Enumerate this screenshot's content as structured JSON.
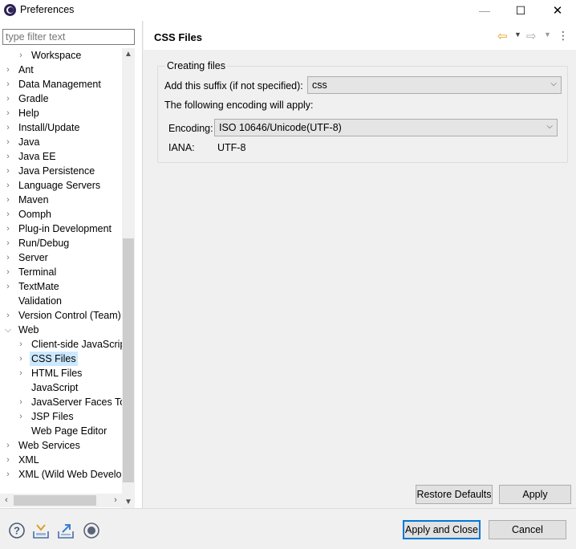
{
  "window": {
    "title": "Preferences",
    "minimize_label": "—",
    "maximize_label": "☐",
    "close_label": "✕"
  },
  "left": {
    "filter_placeholder": "type filter text",
    "tree": [
      {
        "label": "Workspace",
        "level": 1,
        "expandable": true
      },
      {
        "label": "Ant",
        "level": 0,
        "expandable": true
      },
      {
        "label": "Data Management",
        "level": 0,
        "expandable": true
      },
      {
        "label": "Gradle",
        "level": 0,
        "expandable": true
      },
      {
        "label": "Help",
        "level": 0,
        "expandable": true
      },
      {
        "label": "Install/Update",
        "level": 0,
        "expandable": true
      },
      {
        "label": "Java",
        "level": 0,
        "expandable": true
      },
      {
        "label": "Java EE",
        "level": 0,
        "expandable": true
      },
      {
        "label": "Java Persistence",
        "level": 0,
        "expandable": true
      },
      {
        "label": "Language Servers",
        "level": 0,
        "expandable": true
      },
      {
        "label": "Maven",
        "level": 0,
        "expandable": true
      },
      {
        "label": "Oomph",
        "level": 0,
        "expandable": true
      },
      {
        "label": "Plug-in Development",
        "level": 0,
        "expandable": true
      },
      {
        "label": "Run/Debug",
        "level": 0,
        "expandable": true
      },
      {
        "label": "Server",
        "level": 0,
        "expandable": true
      },
      {
        "label": "Terminal",
        "level": 0,
        "expandable": true
      },
      {
        "label": "TextMate",
        "level": 0,
        "expandable": true
      },
      {
        "label": "Validation",
        "level": 0,
        "expandable": false
      },
      {
        "label": "Version Control (Team)",
        "level": 0,
        "expandable": true
      },
      {
        "label": "Web",
        "level": 0,
        "expandable": true,
        "expanded": true
      },
      {
        "label": "Client-side JavaScript",
        "level": 1,
        "expandable": true
      },
      {
        "label": "CSS Files",
        "level": 1,
        "expandable": true,
        "selected": true
      },
      {
        "label": "HTML Files",
        "level": 1,
        "expandable": true
      },
      {
        "label": "JavaScript",
        "level": 1,
        "expandable": false
      },
      {
        "label": "JavaServer Faces Tools",
        "level": 1,
        "expandable": true
      },
      {
        "label": "JSP Files",
        "level": 1,
        "expandable": true
      },
      {
        "label": "Web Page Editor",
        "level": 1,
        "expandable": false
      },
      {
        "label": "Web Services",
        "level": 0,
        "expandable": true
      },
      {
        "label": "XML",
        "level": 0,
        "expandable": true
      },
      {
        "label": "XML (Wild Web Developer)",
        "level": 0,
        "expandable": true
      }
    ]
  },
  "page": {
    "title": "CSS Files",
    "group_title": "Creating files",
    "suffix_label": "Add this suffix (if not specified):",
    "suffix_value": "css",
    "encoding_note": "The following encoding will apply:",
    "encoding_label": "Encoding:",
    "encoding_value": "ISO 10646/Unicode(UTF-8)",
    "iana_label": "IANA:",
    "iana_value": "UTF-8",
    "restore_defaults": "Restore Defaults",
    "apply": "Apply"
  },
  "footer": {
    "apply_and_close": "Apply and Close",
    "cancel": "Cancel"
  }
}
